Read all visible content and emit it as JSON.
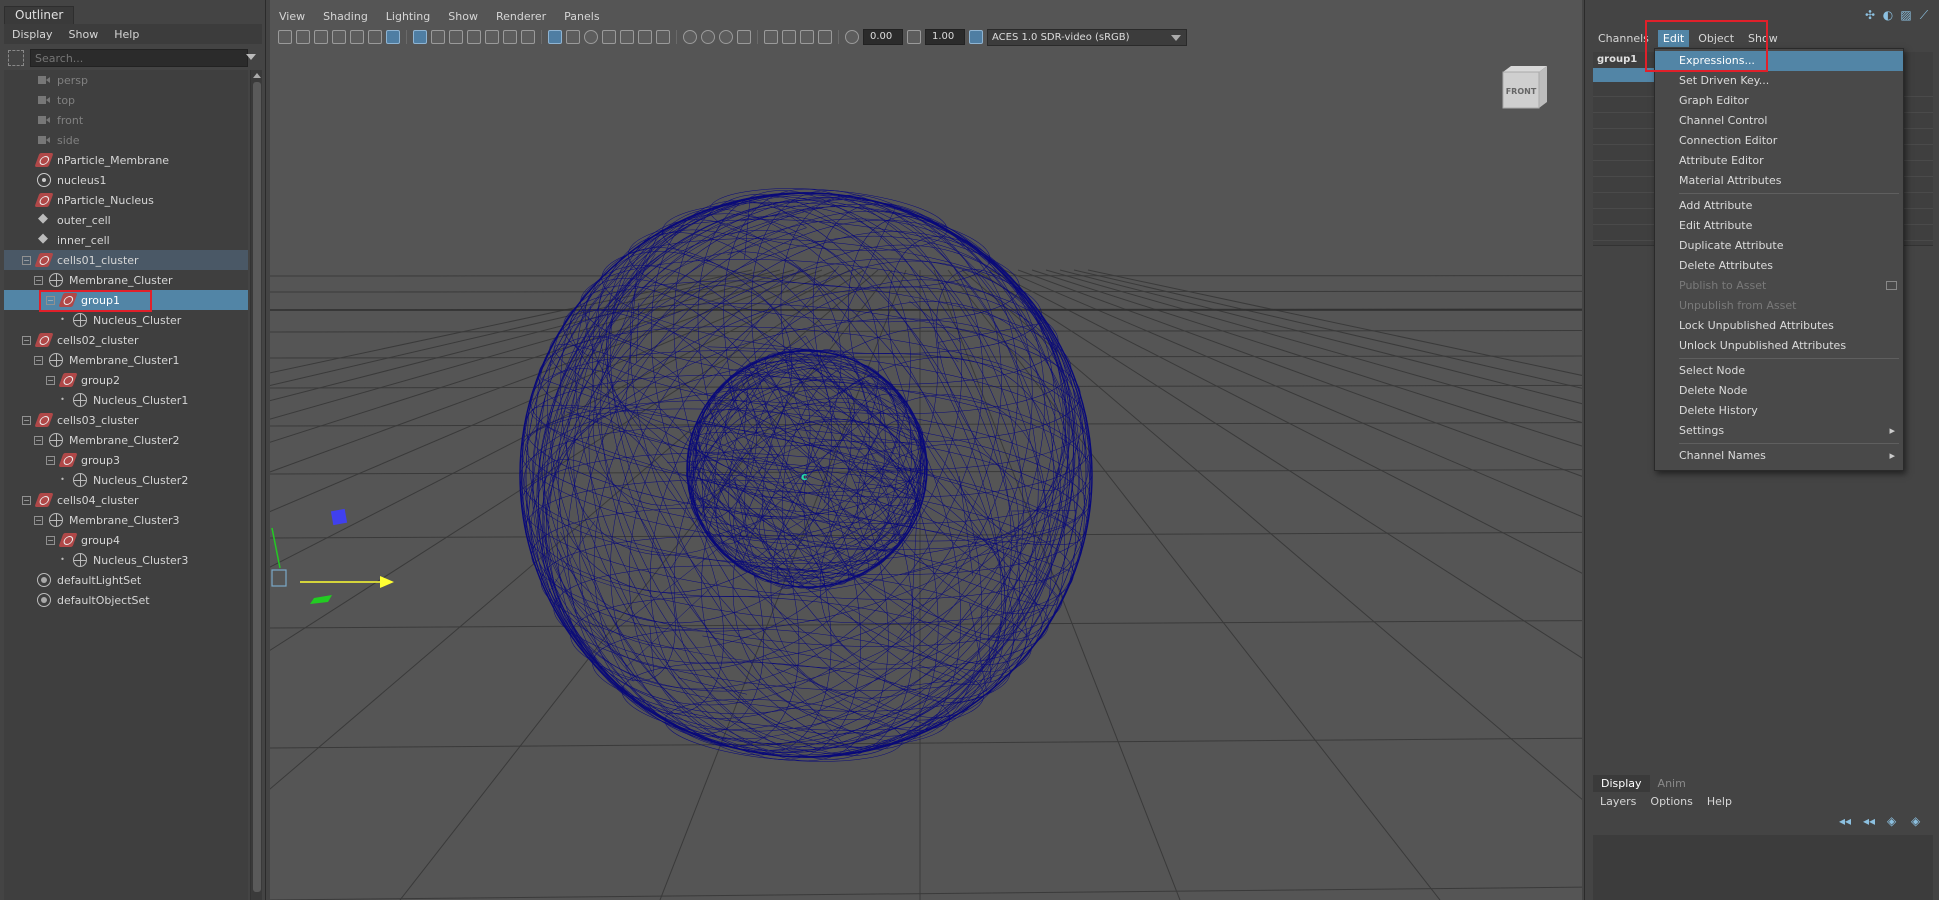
{
  "outliner": {
    "title": "Outliner",
    "menu": [
      "Display",
      "Show",
      "Help"
    ],
    "search_placeholder": "Search...",
    "items": [
      {
        "label": "persp",
        "icon": "camera-icon"
      },
      {
        "label": "top",
        "icon": "camera-icon"
      },
      {
        "label": "front",
        "icon": "camera-icon"
      },
      {
        "label": "side",
        "icon": "camera-icon"
      },
      {
        "label": "nParticle_Membrane",
        "icon": "nparticle-icon"
      },
      {
        "label": "nucleus1",
        "icon": "nucleus-icon"
      },
      {
        "label": "nParticle_Nucleus",
        "icon": "nparticle-icon"
      },
      {
        "label": "outer_cell",
        "icon": "transform-icon"
      },
      {
        "label": "inner_cell",
        "icon": "transform-icon"
      },
      {
        "label": "cells01_cluster",
        "icon": "nparticle-icon"
      },
      {
        "label": "Membrane_Cluster",
        "icon": "cluster-icon"
      },
      {
        "label": "group1",
        "icon": "nparticle-icon"
      },
      {
        "label": "Nucleus_Cluster",
        "icon": "cluster-icon"
      },
      {
        "label": "cells02_cluster",
        "icon": "nparticle-icon"
      },
      {
        "label": "Membrane_Cluster1",
        "icon": "cluster-icon"
      },
      {
        "label": "group2",
        "icon": "nparticle-icon"
      },
      {
        "label": "Nucleus_Cluster1",
        "icon": "cluster-icon"
      },
      {
        "label": "cells03_cluster",
        "icon": "nparticle-icon"
      },
      {
        "label": "Membrane_Cluster2",
        "icon": "cluster-icon"
      },
      {
        "label": "group3",
        "icon": "nparticle-icon"
      },
      {
        "label": "Nucleus_Cluster2",
        "icon": "cluster-icon"
      },
      {
        "label": "cells04_cluster",
        "icon": "nparticle-icon"
      },
      {
        "label": "Membrane_Cluster3",
        "icon": "cluster-icon"
      },
      {
        "label": "group4",
        "icon": "nparticle-icon"
      },
      {
        "label": "Nucleus_Cluster3",
        "icon": "cluster-icon"
      },
      {
        "label": "defaultLightSet",
        "icon": "set-icon"
      },
      {
        "label": "defaultObjectSet",
        "icon": "set-icon"
      }
    ]
  },
  "viewport": {
    "menu": [
      "View",
      "Shading",
      "Lighting",
      "Show",
      "Renderer",
      "Panels"
    ],
    "exposure": "0.00",
    "gamma": "1.00",
    "color_space": "ACES 1.0 SDR-video (sRGB)",
    "viewcube_label": "FRONT",
    "colors": {
      "wire": "#0a0a7a",
      "background": "#555555",
      "grid": "#3a3a3a"
    }
  },
  "channel_box": {
    "menu": [
      "Channels",
      "Edit",
      "Object",
      "Show"
    ],
    "node_name": "group1"
  },
  "edit_menu": {
    "items": [
      {
        "label": "Expressions...",
        "state": "highlighted"
      },
      {
        "label": "Set Driven Key..."
      },
      {
        "label": "Graph Editor"
      },
      {
        "label": "Channel Control"
      },
      {
        "label": "Connection Editor"
      },
      {
        "label": "Attribute Editor"
      },
      {
        "label": "Material Attributes"
      },
      {
        "sep": true
      },
      {
        "label": "Add Attribute"
      },
      {
        "label": "Edit Attribute"
      },
      {
        "label": "Duplicate Attribute"
      },
      {
        "label": "Delete Attributes"
      },
      {
        "label": "Publish to Asset",
        "state": "disabled",
        "option_box": true
      },
      {
        "label": "Unpublish from Asset",
        "state": "disabled"
      },
      {
        "label": "Lock Unpublished Attributes"
      },
      {
        "label": "Unlock Unpublished Attributes"
      },
      {
        "sep": true
      },
      {
        "label": "Select Node"
      },
      {
        "label": "Delete Node"
      },
      {
        "label": "Delete History"
      },
      {
        "label": "Settings",
        "submenu": true
      },
      {
        "sep": true
      },
      {
        "label": "Channel Names",
        "submenu": true
      }
    ]
  },
  "layer_editor": {
    "tabs": [
      "Display",
      "Anim"
    ],
    "menu": [
      "Layers",
      "Options",
      "Help"
    ]
  },
  "colors": {
    "selection": "#5285a6",
    "highlight_box": "#e0202a"
  }
}
